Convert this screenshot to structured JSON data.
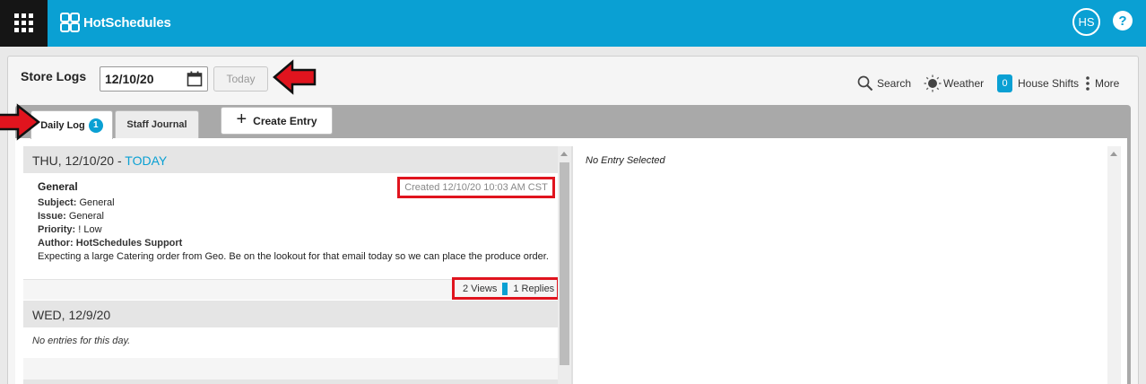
{
  "app": {
    "logo_text": "HotSchedules",
    "avatar_initials": "HS",
    "help_label": "?",
    "accent_color": "#0aa0d3",
    "highlight_color": "#e0141e"
  },
  "header": {
    "title": "Store Logs",
    "date_value": "12/10/20",
    "today_label": "Today"
  },
  "toolbar": {
    "search_label": "Search",
    "weather_label": "Weather",
    "house_shifts_count": "0",
    "house_shifts_label": "House Shifts",
    "more_label": "More"
  },
  "tabs": [
    {
      "label": "Daily Log",
      "badge": "1",
      "active": true
    },
    {
      "label": "Staff Journal",
      "active": false
    }
  ],
  "create_entry_label": "Create Entry",
  "days": [
    {
      "date_label": "THU, 12/10/20",
      "separator": " - ",
      "today_tag": "TODAY",
      "entry": {
        "title": "General",
        "created": "Created 12/10/20 10:03 AM CST",
        "fields": [
          {
            "label": "Subject:",
            "value": " General"
          },
          {
            "label": "Issue:",
            "value": " General"
          },
          {
            "label": "Priority:",
            "value": " ! Low"
          },
          {
            "label": "Author:",
            "value": " HotSchedules Support"
          }
        ],
        "body": "Expecting a large Catering order from Geo. Be on the lookout for that email today so we can place the produce order.",
        "views": "2 Views",
        "replies": "1 Replies"
      }
    },
    {
      "date_label": "WED, 12/9/20",
      "empty_text": "No entries for this day."
    }
  ],
  "detail_empty_text": "No Entry Selected"
}
